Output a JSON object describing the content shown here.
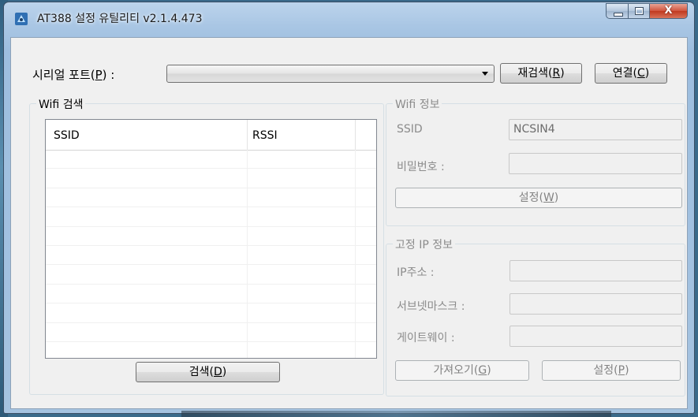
{
  "window": {
    "title": "AT388 설정 유틸리티 v2.1.4.473",
    "close_glyph": "X"
  },
  "serial": {
    "label_pre": "시리얼 포트(",
    "label_key": "P",
    "label_post": ") :",
    "selected": "",
    "rescan_pre": "재검색(",
    "rescan_key": "R",
    "rescan_post": ")",
    "connect_pre": "연결(",
    "connect_key": "C",
    "connect_post": ")"
  },
  "wifi_search": {
    "group_title": "Wifi 검색",
    "columns": [
      "SSID",
      "RSSI"
    ],
    "rows": [],
    "search_pre": "검색(",
    "search_key": "D",
    "search_post": ")"
  },
  "wifi_info": {
    "group_title": "Wifi 정보",
    "ssid_label": "SSID",
    "ssid_value": "NCSIN4",
    "password_label": "비밀번호 :",
    "password_value": "",
    "set_pre": "설정(",
    "set_key": "W",
    "set_post": ")"
  },
  "static_ip": {
    "group_title": "고정 IP 정보",
    "ip_label": "IP주소 :",
    "ip_value": "",
    "subnet_label": "서브넷마스크 :",
    "subnet_value": "",
    "gateway_label": "게이트웨이 :",
    "gateway_value": "",
    "get_pre": "가져오기(",
    "get_key": "G",
    "get_post": ")",
    "set_pre": "설정(",
    "set_key": "P",
    "set_post": ")"
  },
  "colors": {
    "window_frame": "#a9c6e4",
    "client_bg": "#f0f0f0",
    "close_button": "#c0391f",
    "disabled_text": "#8b8b8b"
  }
}
